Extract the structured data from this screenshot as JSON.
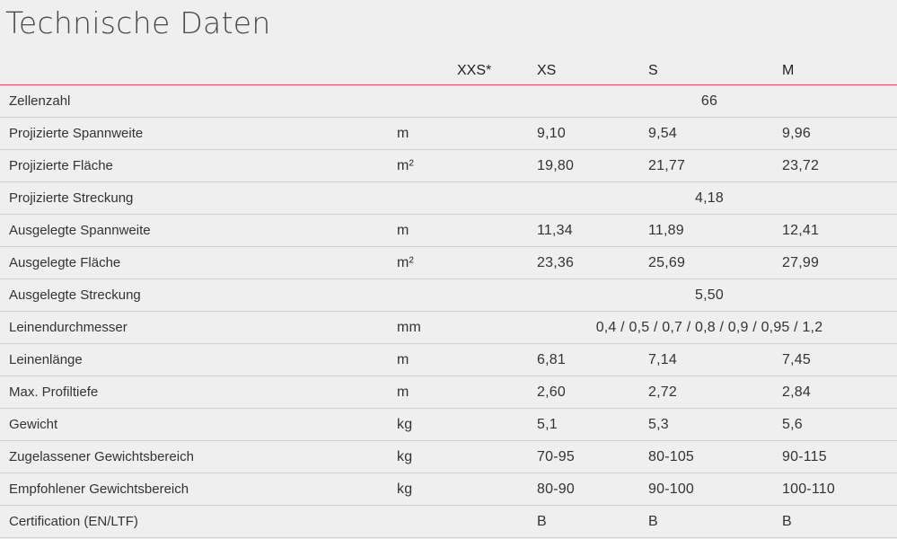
{
  "title": "Technische Daten",
  "header": {
    "label": "",
    "unit": "",
    "sizes": [
      "XXS*",
      "XS",
      "S",
      "M"
    ]
  },
  "rows": [
    {
      "label": "Zellenzahl",
      "unit": "",
      "span": "66"
    },
    {
      "label": "Projizierte Spannweite",
      "unit": "m",
      "xs": "9,10",
      "s": "9,54",
      "m": "9,96"
    },
    {
      "label": "Projizierte Fläche",
      "unit": "m²",
      "xs": "19,80",
      "s": "21,77",
      "m": "23,72"
    },
    {
      "label": "Projizierte Streckung",
      "unit": "",
      "span": "4,18"
    },
    {
      "label": "Ausgelegte Spannweite",
      "unit": "m",
      "xs": "11,34",
      "s": "11,89",
      "m": "12,41"
    },
    {
      "label": "Ausgelegte Fläche",
      "unit": "m²",
      "xs": "23,36",
      "s": "25,69",
      "m": "27,99"
    },
    {
      "label": "Ausgelegte Streckung",
      "unit": "",
      "span": "5,50"
    },
    {
      "label": "Leinendurchmesser",
      "unit": "mm",
      "span": "0,4 / 0,5 / 0,7 / 0,8 / 0,9 / 0,95 / 1,2"
    },
    {
      "label": "Leinenlänge",
      "unit": "m",
      "xs": "6,81",
      "s": "7,14",
      "m": "7,45"
    },
    {
      "label": "Max. Profiltiefe",
      "unit": "m",
      "xs": "2,60",
      "s": "2,72",
      "m": "2,84"
    },
    {
      "label": "Gewicht",
      "unit": "kg",
      "xs": "5,1",
      "s": "5,3",
      "m": "5,6"
    },
    {
      "label": "Zugelassener Gewichtsbereich",
      "unit": "kg",
      "xs": "70-95",
      "s": "80-105",
      "m": "90-115"
    },
    {
      "label": "Empfohlener Gewichtsbereich",
      "unit": "kg",
      "xs": "80-90",
      "s": "90-100",
      "m": "100-110"
    },
    {
      "label": "Certification (EN/LTF)",
      "unit": "",
      "xs": "B",
      "s": "B",
      "m": "B"
    }
  ],
  "colors": {
    "background": "#efefef",
    "header_rule": "#d9534f",
    "row_rule": "#cdcdcd",
    "text": "#333333"
  }
}
